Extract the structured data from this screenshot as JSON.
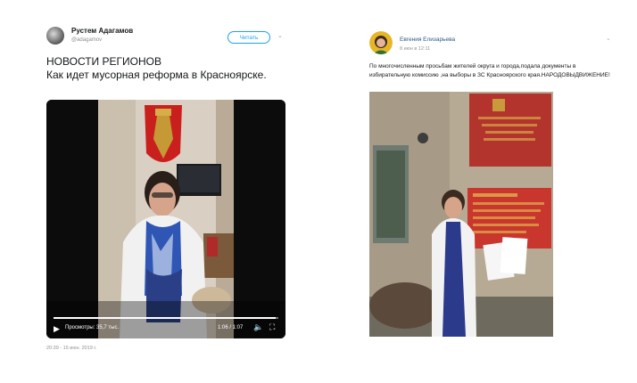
{
  "tweet": {
    "author_name": "Рустем Адагамов",
    "author_handle": "@adagamov",
    "follow_label": "Читать",
    "menu_icon": "chevron-down-icon",
    "headline": "НОВОСТИ РЕГИОНОВ",
    "body": "Как идет мусорная реформа в Красноярске.",
    "video": {
      "views": "Просмотры: 35,7 тыс.",
      "time": "1:06 / 1:07",
      "progress": 0.99
    },
    "date": "20:39 - 15 июн. 2019 г."
  },
  "vk_post": {
    "author_name": "Евгения Елизарьева",
    "date": "8 июн в 12:11",
    "menu_icon": "chevron-down-icon",
    "text": "По многочисленным просьбам жителей округа и города,подала документы в избирательную комиссию ,на выборы в ЗС Красноярского края.НАРОДОВЫДВИЖЕНИЕ!"
  },
  "colors": {
    "twitter_blue": "#1da1f2",
    "vk_link": "#2a5885",
    "muted_text": "#8a8f94"
  }
}
